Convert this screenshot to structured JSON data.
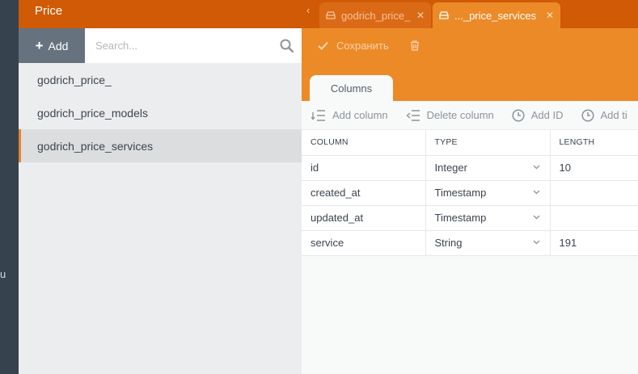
{
  "leftnav": {
    "fragment": "u"
  },
  "sidebar": {
    "title": "Price",
    "add_label": "Add",
    "search_placeholder": "Search...",
    "items": [
      {
        "label": "godrich_price_",
        "active": false
      },
      {
        "label": "godrich_price_models",
        "active": false
      },
      {
        "label": "godrich_price_services",
        "active": true
      }
    ]
  },
  "tabs": [
    {
      "label": "godrich_price_",
      "active": false
    },
    {
      "label": "..._price_services",
      "active": true
    }
  ],
  "toolbar": {
    "save_label": "Сохранить"
  },
  "subtabs": {
    "columns_label": "Columns"
  },
  "column_toolbar": {
    "add_column": "Add column",
    "delete_column": "Delete column",
    "add_id": "Add ID",
    "add_timestamps": "Add ti"
  },
  "table": {
    "headers": [
      "COLUMN",
      "TYPE",
      "LENGTH"
    ],
    "rows": [
      {
        "column": "id",
        "type": "Integer",
        "length": "10"
      },
      {
        "column": "created_at",
        "type": "Timestamp",
        "length": ""
      },
      {
        "column": "updated_at",
        "type": "Timestamp",
        "length": ""
      },
      {
        "column": "service",
        "type": "String",
        "length": "191"
      }
    ]
  },
  "colors": {
    "header_orange": "#d05a05",
    "accent_orange": "#ec8a28",
    "nav_dark": "#36424e",
    "sidebar_bg": "#ecedee"
  }
}
